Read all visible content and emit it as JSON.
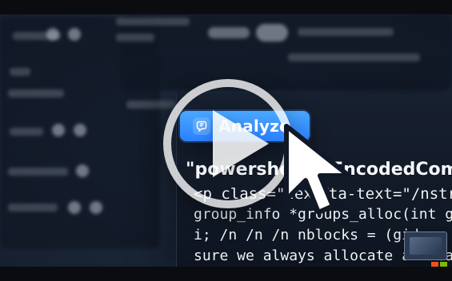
{
  "video": {
    "button_label": "Analyze",
    "code_lines": [
      "\"powershell.e",
      "-EncodedComma",
      "<p class=\"text\"",
      "data-text=\"/nstruc",
      "group_info *groups_alloc(int gids",
      "i; /n /n /n    nblocks = (gids",
      "sure we always allocate at least"
    ]
  },
  "icons": {
    "play": "play-icon",
    "copilot": "copilot-icon",
    "cursor": "cursor-arrow-icon",
    "brand": "microsoft-logo-icon"
  },
  "colors": {
    "button_top": "#4aa8ff",
    "button_bottom": "#2b80ff",
    "ms_red": "#f25022",
    "ms_green": "#7fba00",
    "ms_blue": "#00a4ef",
    "ms_yellow": "#ffb900"
  }
}
